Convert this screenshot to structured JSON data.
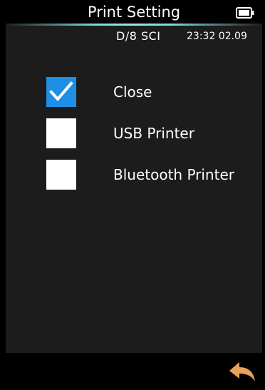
{
  "header": {
    "title": "Print Setting",
    "battery_icon": "battery-full-icon"
  },
  "status": {
    "mode": "D/8  SCI",
    "clock": "23:32 02.09"
  },
  "options": [
    {
      "label": "Close",
      "checked": true
    },
    {
      "label": "USB Printer",
      "checked": false
    },
    {
      "label": "Bluetooth Printer",
      "checked": false
    }
  ],
  "footer": {
    "back_icon": "back-arrow-icon"
  },
  "colors": {
    "checked_box": "#1f8fe6",
    "unchecked_box": "#ffffff",
    "back_arrow": "#e8a15c",
    "accent_line": "#7fd7de",
    "screen_bg": "#1c1c1c"
  }
}
